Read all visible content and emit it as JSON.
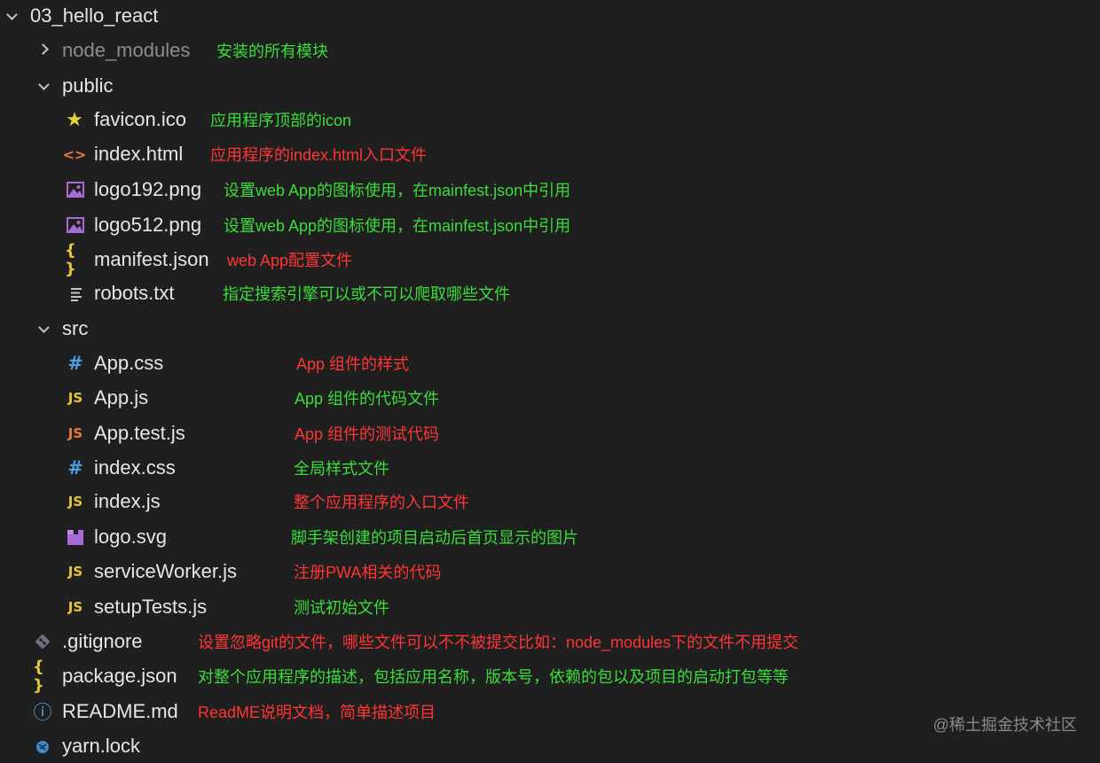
{
  "root": {
    "name": "03_hello_react"
  },
  "items": {
    "node_modules": {
      "name": "node_modules",
      "note": "安装的所有模块"
    },
    "public": {
      "name": "public"
    },
    "favicon": {
      "name": "favicon.ico",
      "note": "应用程序顶部的icon"
    },
    "index_html": {
      "name": "index.html",
      "note": "应用程序的index.html入口文件"
    },
    "logo192": {
      "name": "logo192.png",
      "note": "设置web App的图标使用，在mainfest.json中引用"
    },
    "logo512": {
      "name": "logo512.png",
      "note": "设置web App的图标使用，在mainfest.json中引用"
    },
    "manifest": {
      "name": "manifest.json",
      "note": "web App配置文件"
    },
    "robots": {
      "name": "robots.txt",
      "note": "指定搜索引擎可以或不可以爬取哪些文件"
    },
    "src": {
      "name": "src"
    },
    "app_css": {
      "name": "App.css",
      "note": "App 组件的样式"
    },
    "app_js": {
      "name": "App.js",
      "note": "App 组件的代码文件"
    },
    "app_test": {
      "name": "App.test.js",
      "note": "App 组件的测试代码"
    },
    "index_css": {
      "name": "index.css",
      "note": "全局样式文件"
    },
    "index_js": {
      "name": "index.js",
      "note": "整个应用程序的入口文件"
    },
    "logo_svg": {
      "name": "logo.svg",
      "note": "脚手架创建的项目启动后首页显示的图片"
    },
    "service_worker": {
      "name": "serviceWorker.js",
      "note": "注册PWA相关的代码"
    },
    "setup_tests": {
      "name": "setupTests.js",
      "note": "测试初始文件"
    },
    "gitignore": {
      "name": ".gitignore",
      "note": "设置忽略git的文件，哪些文件可以不不被提交比如：node_modules下的文件不用提交"
    },
    "package_json": {
      "name": "package.json",
      "note": "对整个应用程序的描述，包括应用名称，版本号，依赖的包以及项目的启动打包等等"
    },
    "readme": {
      "name": "README.md",
      "note": "ReadME说明文档，简单描述项目"
    },
    "yarn_lock": {
      "name": "yarn.lock"
    }
  },
  "icons": {
    "js_label": "JS",
    "hash_label": "#",
    "braces_label": "{ }",
    "code_label": "<>",
    "star_label": "★",
    "info_label": "ⓘ"
  },
  "colors": {
    "background": "#1f1f1f",
    "note_green": "#3bdc3b",
    "note_red": "#ff3535",
    "js_yellow": "#e3c53a",
    "js_orange": "#e8793e",
    "css_blue": "#4b9ce0",
    "image_purple": "#a66bd6"
  },
  "watermark": "@稀土掘金技术社区"
}
